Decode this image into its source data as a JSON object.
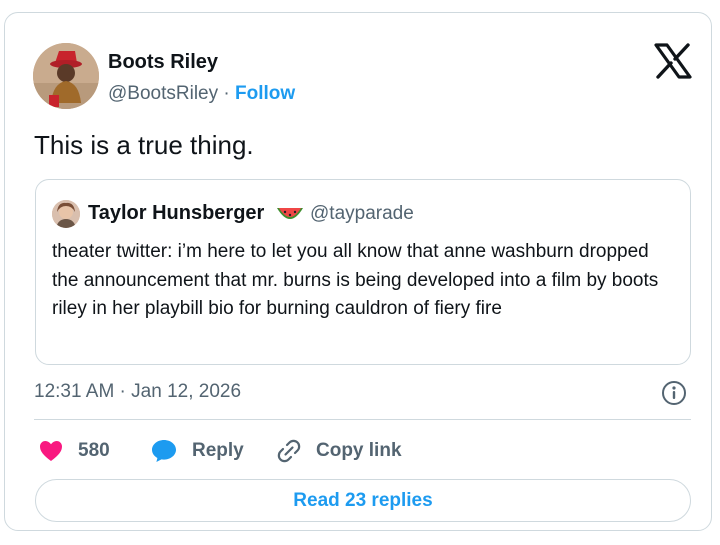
{
  "author": {
    "name": "Boots Riley",
    "handle": "@BootsRiley",
    "separator": "·",
    "follow_label": "Follow"
  },
  "tweet": {
    "text": "This is a true thing.",
    "timestamp": "12:31 AM · Jan 12, 2026"
  },
  "quote": {
    "name": "Taylor Hunsberger",
    "emoji": "watermelon-icon",
    "handle": "@tayparade",
    "text": "theater twitter: i’m here to let you all know that anne washburn dropped the announcement that mr. burns is being developed into a film by boots riley in her playbill bio for burning cauldron of fiery fire"
  },
  "actions": {
    "likes": "580",
    "reply_label": "Reply",
    "copy_link_label": "Copy link"
  },
  "read_replies_label": "Read 23 replies",
  "colors": {
    "accent": "#1d9bf0",
    "like": "#f91880",
    "muted": "#536471",
    "border": "#cfd9de"
  },
  "icons": [
    "x-logo-icon",
    "info-icon",
    "heart-icon",
    "speech-bubble-icon",
    "link-icon",
    "watermelon-icon"
  ]
}
